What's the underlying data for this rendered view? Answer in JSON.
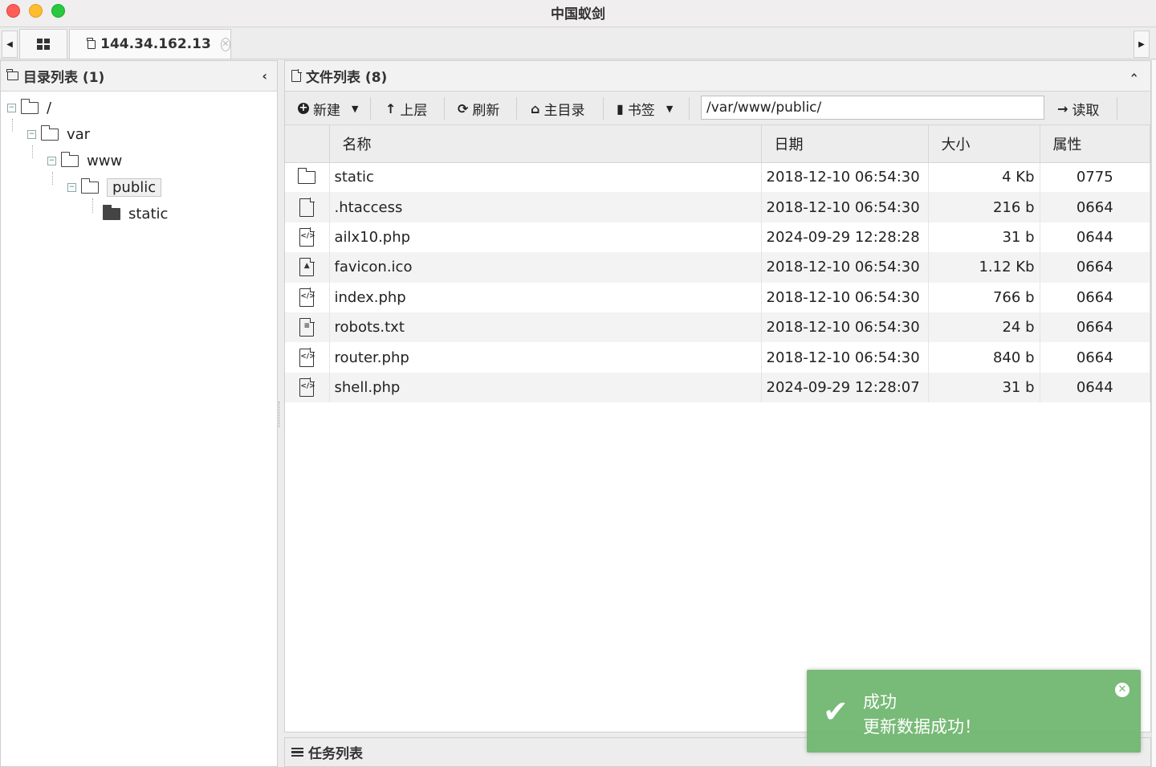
{
  "window": {
    "title": "中国蚁剑"
  },
  "tabs": {
    "server_tab_label": "144.34.162.13",
    "close_glyph": "✕"
  },
  "dir_panel": {
    "title": "目录列表 (1)",
    "tree": [
      {
        "label": "/",
        "toggle": "−"
      },
      {
        "label": "var",
        "toggle": "−"
      },
      {
        "label": "www",
        "toggle": "−"
      },
      {
        "label": "public",
        "toggle": "−",
        "selected": true
      },
      {
        "label": "static"
      }
    ]
  },
  "file_panel": {
    "title": "文件列表 (8)",
    "toolbar": {
      "new_label": "新建",
      "up_label": "上层",
      "refresh_label": "刷新",
      "home_label": "主目录",
      "bookmark_label": "书签",
      "path_value": "/var/www/public/",
      "read_label": "读取"
    },
    "columns": {
      "name": "名称",
      "date": "日期",
      "size": "大小",
      "attr": "属性"
    },
    "files": [
      {
        "name": "static",
        "date": "2018-12-10 06:54:30",
        "size": "4 Kb",
        "attr": "0775",
        "icon": "folder-icon"
      },
      {
        "name": ".htaccess",
        "date": "2018-12-10 06:54:30",
        "size": "216 b",
        "attr": "0664",
        "icon": "file-icon"
      },
      {
        "name": "ailx10.php",
        "date": "2024-09-29 12:28:28",
        "size": "31 b",
        "attr": "0644",
        "icon": "code-file-icon"
      },
      {
        "name": "favicon.ico",
        "date": "2018-12-10 06:54:30",
        "size": "1.12 Kb",
        "attr": "0664",
        "icon": "image-file-icon"
      },
      {
        "name": "index.php",
        "date": "2018-12-10 06:54:30",
        "size": "766 b",
        "attr": "0664",
        "icon": "code-file-icon"
      },
      {
        "name": "robots.txt",
        "date": "2018-12-10 06:54:30",
        "size": "24 b",
        "attr": "0664",
        "icon": "text-file-icon"
      },
      {
        "name": "router.php",
        "date": "2018-12-10 06:54:30",
        "size": "840 b",
        "attr": "0664",
        "icon": "code-file-icon"
      },
      {
        "name": "shell.php",
        "date": "2024-09-29 12:28:07",
        "size": "31 b",
        "attr": "0644",
        "icon": "code-file-icon"
      }
    ]
  },
  "task_panel": {
    "title": "任务列表"
  },
  "toast": {
    "title": "成功",
    "message": "更新数据成功！",
    "color": "#74b873"
  }
}
